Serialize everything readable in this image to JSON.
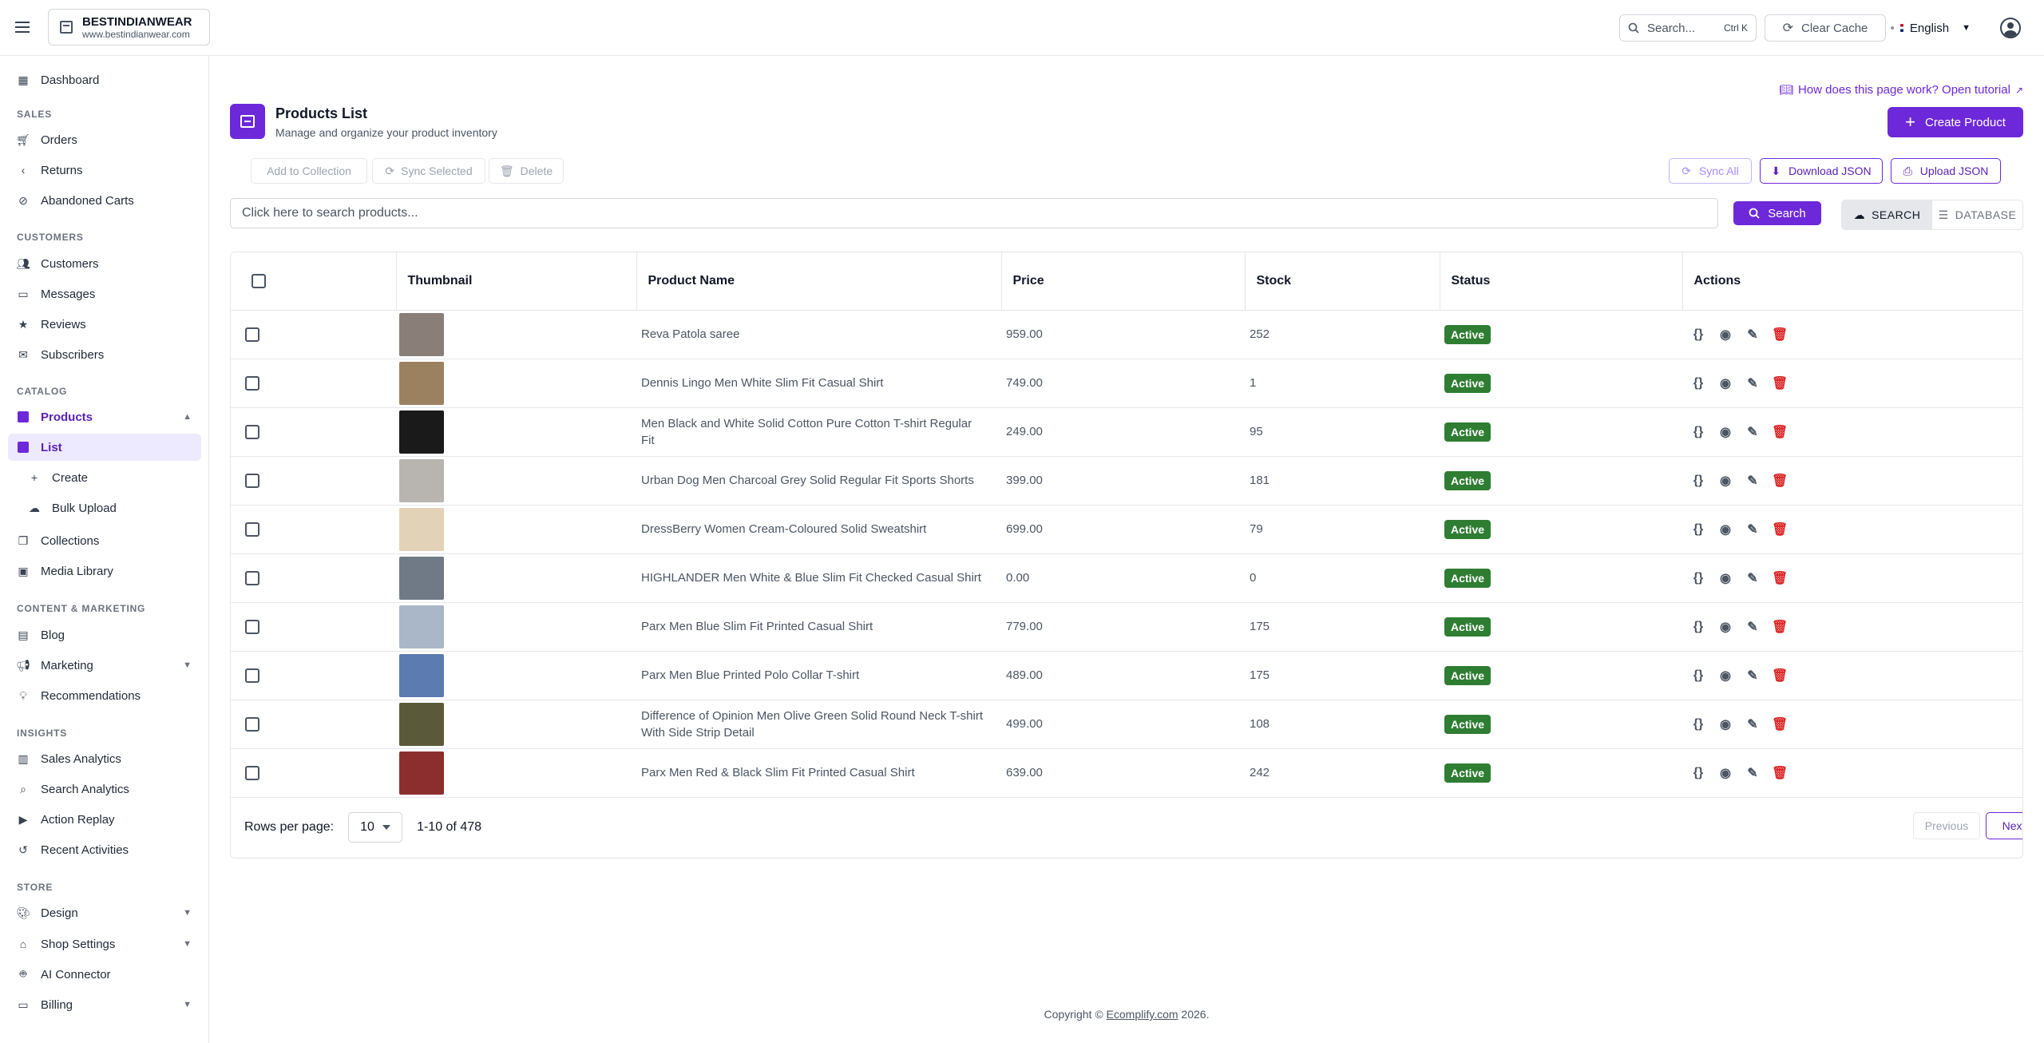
{
  "header": {
    "store_name": "BESTINDIANWEAR",
    "store_url": "www.bestindianwear.com",
    "search_placeholder": "Search...",
    "search_shortcut": "Ctrl K",
    "clear_cache_label": "Clear Cache",
    "language": "English"
  },
  "sidebar": {
    "dashboard": "Dashboard",
    "sales_section": "SALES",
    "orders": "Orders",
    "returns": "Returns",
    "abandoned_carts": "Abandoned Carts",
    "customers_section": "CUSTOMERS",
    "customers": "Customers",
    "messages": "Messages",
    "reviews": "Reviews",
    "subscribers": "Subscribers",
    "catalog_section": "CATALOG",
    "products": "Products",
    "list": "List",
    "create": "Create",
    "bulk_upload": "Bulk Upload",
    "collections": "Collections",
    "media_library": "Media Library",
    "content_section": "CONTENT & MARKETING",
    "blog": "Blog",
    "marketing": "Marketing",
    "recommendations": "Recommendations",
    "insights_section": "INSIGHTS",
    "sales_analytics": "Sales Analytics",
    "search_analytics": "Search Analytics",
    "action_replay": "Action Replay",
    "recent_activities": "Recent Activities",
    "store_section": "STORE",
    "design": "Design",
    "shop_settings": "Shop Settings",
    "ai_connector": "AI Connector",
    "billing": "Billing"
  },
  "page": {
    "tutorial_link": "How does this page work? Open tutorial",
    "title": "Products List",
    "subtitle": "Manage and organize your product inventory",
    "create_button": "Create Product",
    "add_to_collection": "Add to Collection",
    "sync_selected": "Sync Selected",
    "delete": "Delete",
    "sync_all": "Sync All",
    "download_json": "Download JSON",
    "upload_json": "Upload JSON",
    "search_placeholder": "Click here to search products...",
    "search_button": "Search",
    "toggle_search": "SEARCH",
    "toggle_database": "DATABASE"
  },
  "table": {
    "columns": [
      "Thumbnail",
      "Product Name",
      "Price",
      "Stock",
      "Status",
      "Actions"
    ],
    "rows": [
      {
        "name": "Reva Patola saree",
        "price": "959.00",
        "stock": "252",
        "status": "Active",
        "thumb_color": "#8a7f78"
      },
      {
        "name": "Dennis Lingo Men White Slim Fit Casual Shirt",
        "price": "749.00",
        "stock": "1",
        "status": "Active",
        "thumb_color": "#9c8161"
      },
      {
        "name": "Men Black and White Solid Cotton Pure Cotton T-shirt Regular Fit",
        "price": "249.00",
        "stock": "95",
        "status": "Active",
        "thumb_color": "#1a1a1a"
      },
      {
        "name": "Urban Dog Men Charcoal Grey Solid Regular Fit Sports Shorts",
        "price": "399.00",
        "stock": "181",
        "status": "Active",
        "thumb_color": "#b8b4b0"
      },
      {
        "name": "DressBerry Women Cream-Coloured Solid Sweatshirt",
        "price": "699.00",
        "stock": "79",
        "status": "Active",
        "thumb_color": "#e2d3b8"
      },
      {
        "name": "HIGHLANDER Men White & Blue Slim Fit Checked Casual Shirt",
        "price": "0.00",
        "stock": "0",
        "status": "Active",
        "thumb_color": "#6f7a86"
      },
      {
        "name": "Parx Men Blue Slim Fit Printed Casual Shirt",
        "price": "779.00",
        "stock": "175",
        "status": "Active",
        "thumb_color": "#a9b7c9"
      },
      {
        "name": "Parx Men Blue Printed Polo Collar T-shirt",
        "price": "489.00",
        "stock": "175",
        "status": "Active",
        "thumb_color": "#5c7bb0"
      },
      {
        "name": "Difference of Opinion Men Olive Green Solid Round Neck T-shirt With Side Strip Detail",
        "price": "499.00",
        "stock": "108",
        "status": "Active",
        "thumb_color": "#5a5a3a"
      },
      {
        "name": "Parx Men Red & Black Slim Fit Printed Casual Shirt",
        "price": "639.00",
        "stock": "242",
        "status": "Active",
        "thumb_color": "#8c2e2e"
      }
    ]
  },
  "pagination": {
    "rows_per_page_label": "Rows per page:",
    "rows_per_page": "10",
    "range": "1-10 of 478",
    "previous": "Previous",
    "next": "Next"
  },
  "footer": {
    "prefix": "Copyright © ",
    "link": "Ecomplify.com",
    "suffix": " 2026."
  },
  "colors": {
    "accent": "#6d28d9",
    "active_badge": "#2e7d32",
    "delete": "#dc2626"
  }
}
